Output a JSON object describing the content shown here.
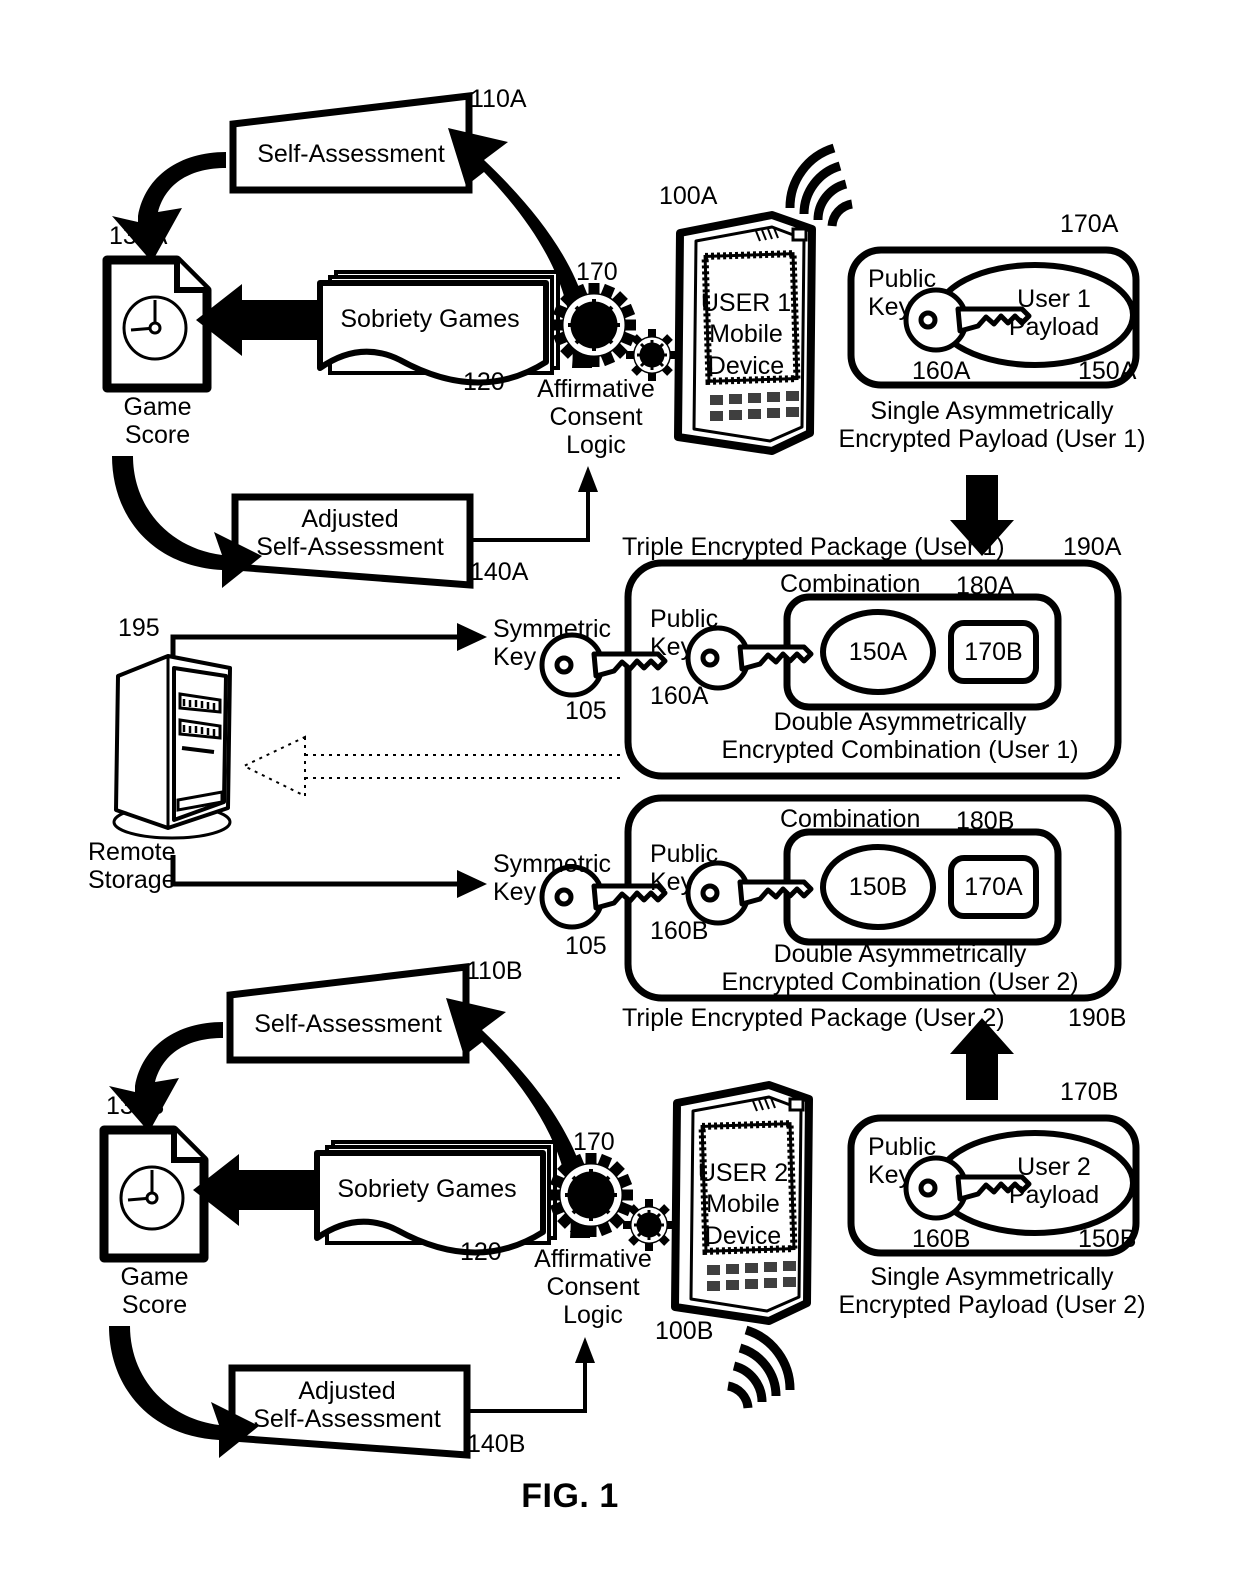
{
  "figure": {
    "caption": "FIG. 1"
  },
  "user1": {
    "self_assessment": {
      "label": "Self-Assessment",
      "ref": "110A"
    },
    "game_score": {
      "label": "Game\nScore",
      "ref": "130A",
      "icon": "document-clock-icon"
    },
    "sobriety_games": {
      "label": "Sobriety Games",
      "ref": "120"
    },
    "affirmative_consent_logic": {
      "label": "Affirmative\nConsent\nLogic",
      "ref": "170",
      "icon": "gears-icon"
    },
    "adjusted_self_assessment": {
      "label": "Adjusted\nSelf-Assessment",
      "ref": "140A"
    },
    "mobile_device": {
      "label": "USER 1\nMobile\nDevice",
      "ref": "100A",
      "icon": "mobile-device-icon"
    },
    "payload_box": {
      "ref": "170A",
      "public_key_label": "Public\nKey",
      "public_key_ref": "160A",
      "payload_label": "User 1\nPayload",
      "payload_ref": "150A",
      "caption": "Single Asymmetrically\nEncrypted Payload (User 1)"
    },
    "triple_package": {
      "title": "Triple Encrypted Package (User 1)",
      "ref": "190A",
      "symmetric_key_label": "Symmetric\nKey",
      "symmetric_key_ref": "105",
      "public_key_label": "Public\nKey",
      "public_key_ref": "160A",
      "combination_label": "Combination",
      "combination_ref": "180A",
      "item_oval": "150A",
      "item_rect": "170B",
      "caption": "Double Asymmetrically\nEncrypted Combination (User 1)"
    }
  },
  "user2": {
    "self_assessment": {
      "label": "Self-Assessment",
      "ref": "110B"
    },
    "game_score": {
      "label": "Game\nScore",
      "ref": "130B",
      "icon": "document-clock-icon"
    },
    "sobriety_games": {
      "label": "Sobriety Games",
      "ref": "120"
    },
    "affirmative_consent_logic": {
      "label": "Affirmative\nConsent\nLogic",
      "ref": "170",
      "icon": "gears-icon"
    },
    "adjusted_self_assessment": {
      "label": "Adjusted\nSelf-Assessment",
      "ref": "140B"
    },
    "mobile_device": {
      "label": "USER 2\nMobile\nDevice",
      "ref": "100B",
      "icon": "mobile-device-icon"
    },
    "payload_box": {
      "ref": "170B",
      "public_key_label": "Public\nKey",
      "public_key_ref": "160B",
      "payload_label": "User 2\nPayload",
      "payload_ref": "150B",
      "caption": "Single Asymmetrically\nEncrypted Payload (User 2)"
    },
    "triple_package": {
      "title": "Triple Encrypted Package (User 2)",
      "ref": "190B",
      "symmetric_key_label": "Symmetric\nKey",
      "symmetric_key_ref": "105",
      "public_key_label": "Public\nKey",
      "public_key_ref": "160B",
      "combination_label": "Combination",
      "combination_ref": "180B",
      "item_oval": "150B",
      "item_rect": "170A",
      "caption": "Double Asymmetrically\nEncrypted Combination (User 2)"
    }
  },
  "remote_storage": {
    "label": "Remote\nStorage",
    "ref": "195",
    "icon": "server-tower-icon"
  }
}
